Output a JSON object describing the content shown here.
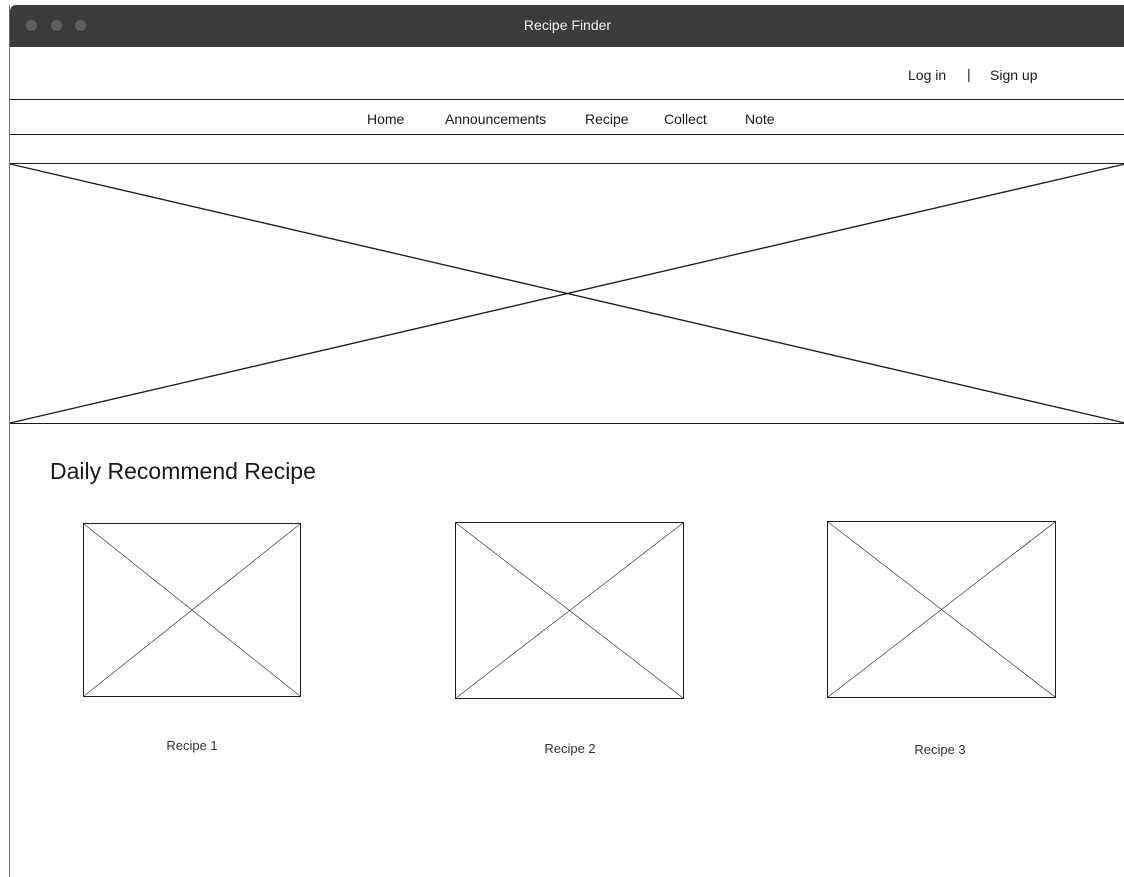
{
  "window": {
    "title": "Recipe Finder"
  },
  "auth": {
    "login_label": "Log in",
    "separator": "|",
    "signup_label": "Sign up"
  },
  "nav": {
    "items": [
      {
        "label": "Home"
      },
      {
        "label": "Announcements"
      },
      {
        "label": "Recipe"
      },
      {
        "label": "Collect"
      },
      {
        "label": "Note"
      }
    ]
  },
  "main": {
    "section_title": "Daily Recommend Recipe",
    "recipes": [
      {
        "label": "Recipe 1"
      },
      {
        "label": "Recipe 2"
      },
      {
        "label": "Recipe 3"
      }
    ]
  },
  "colors": {
    "titlebar": "#3c3c3c",
    "line": "#1a1a1a"
  },
  "icons": {
    "placeholder": "image-placeholder-icon"
  }
}
